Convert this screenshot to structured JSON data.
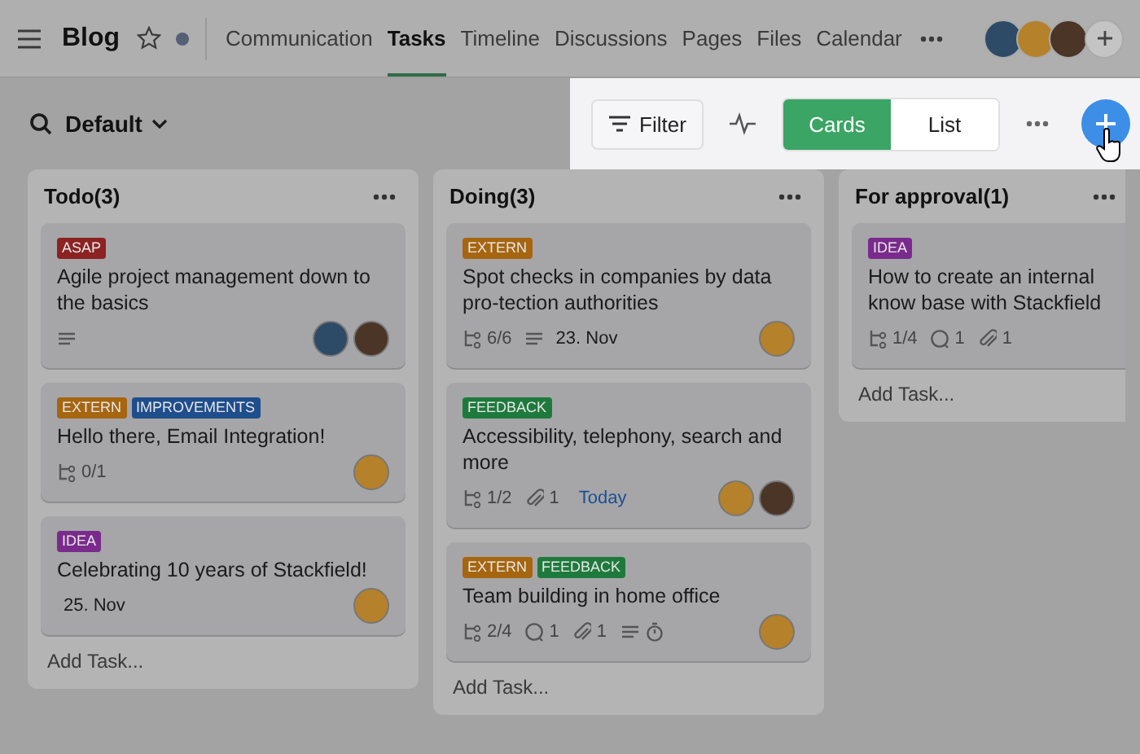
{
  "header": {
    "title": "Blog",
    "starred": false,
    "tabs": [
      {
        "label": "Communication",
        "selected": false
      },
      {
        "label": "Tasks",
        "selected": true
      },
      {
        "label": "Timeline",
        "selected": false
      },
      {
        "label": "Discussions",
        "selected": false
      },
      {
        "label": "Pages",
        "selected": false
      },
      {
        "label": "Files",
        "selected": false
      },
      {
        "label": "Calendar",
        "selected": false
      }
    ],
    "members": [
      {
        "color": "#2d4a66"
      },
      {
        "color": "#b5812a"
      },
      {
        "color": "#4a3526"
      }
    ]
  },
  "toolbar": {
    "view": "Default",
    "filter": "Filter",
    "view_toggle": [
      {
        "label": "Cards",
        "selected": true
      },
      {
        "label": "List",
        "selected": false
      }
    ]
  },
  "columns": [
    {
      "title": "Todo(3)",
      "add_task": "Add Task...",
      "cards": [
        {
          "tags": [
            {
              "label": "ASAP",
              "color": "#8c2222"
            }
          ],
          "title": "Agile project management down to the basics",
          "meta": [
            {
              "kind": "description"
            }
          ],
          "assignees": [
            {
              "color": "#2d4a66"
            },
            {
              "color": "#4a3526"
            }
          ]
        },
        {
          "tags": [
            {
              "label": "EXTERN",
              "color": "#a6650f"
            },
            {
              "label": "IMPROVEMENTS",
              "color": "#1f4e8c"
            }
          ],
          "title": "Hello there, Email Integration!",
          "meta": [
            {
              "kind": "subtasks",
              "text": "0/1"
            }
          ],
          "assignees": [
            {
              "color": "#b5812a"
            }
          ]
        },
        {
          "tags": [
            {
              "label": "IDEA",
              "color": "#7a2a8c"
            }
          ],
          "title": "Celebrating 10 years of Stackfield!",
          "meta": [
            {
              "kind": "date",
              "text": "25. Nov"
            }
          ],
          "assignees": [
            {
              "color": "#b5812a"
            }
          ]
        }
      ]
    },
    {
      "title": "Doing(3)",
      "add_task": "Add Task...",
      "cards": [
        {
          "tags": [
            {
              "label": "EXTERN",
              "color": "#a6650f"
            }
          ],
          "title": "Spot checks in companies by data pro-tection authorities",
          "meta": [
            {
              "kind": "subtasks",
              "text": "6/6"
            },
            {
              "kind": "description"
            },
            {
              "kind": "date",
              "text": "23. Nov"
            }
          ],
          "assignees": [
            {
              "color": "#b5812a"
            }
          ]
        },
        {
          "tags": [
            {
              "label": "FEEDBACK",
              "color": "#1e7a3c"
            }
          ],
          "title": "Accessibility, telephony, search and more",
          "meta": [
            {
              "kind": "subtasks",
              "text": "1/2"
            },
            {
              "kind": "attachments",
              "text": "1"
            },
            {
              "kind": "today",
              "text": "Today"
            }
          ],
          "assignees": [
            {
              "color": "#b5812a"
            },
            {
              "color": "#4a3526"
            }
          ]
        },
        {
          "tags": [
            {
              "label": "EXTERN",
              "color": "#a6650f"
            },
            {
              "label": "FEEDBACK",
              "color": "#1e7a3c"
            }
          ],
          "title": "Team building in home office",
          "meta": [
            {
              "kind": "subtasks",
              "text": "2/4"
            },
            {
              "kind": "comments",
              "text": "1"
            },
            {
              "kind": "attachments",
              "text": "1"
            },
            {
              "kind": "description"
            },
            {
              "kind": "timer"
            }
          ],
          "assignees": [
            {
              "color": "#b5812a"
            }
          ]
        }
      ]
    },
    {
      "title": "For approval(1)",
      "add_task": "Add Task...",
      "cards": [
        {
          "tags": [
            {
              "label": "IDEA",
              "color": "#7a2a8c"
            }
          ],
          "title": "How to create an internal know base with Stackfield",
          "meta": [
            {
              "kind": "subtasks",
              "text": "1/4"
            },
            {
              "kind": "comments",
              "text": "1"
            },
            {
              "kind": "attachments",
              "text": "1"
            }
          ]
        }
      ]
    }
  ]
}
